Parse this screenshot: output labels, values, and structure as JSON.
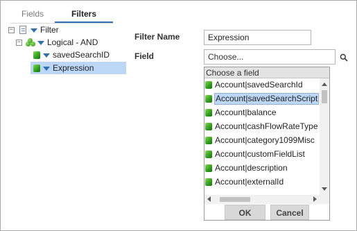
{
  "tabs": {
    "fields": "Fields",
    "filters": "Filters",
    "active": "Filters"
  },
  "tree": {
    "root": {
      "label": "Filter",
      "toggle": "−"
    },
    "logical": {
      "label": "Logical - AND",
      "toggle": "−"
    },
    "children": [
      {
        "label": "savedSearchID",
        "selected": false
      },
      {
        "label": "Expression",
        "selected": true
      }
    ]
  },
  "form": {
    "filter_name_label": "Filter Name",
    "filter_name_value": "Expression",
    "field_label": "Field",
    "field_placeholder": "Choose..."
  },
  "dropdown": {
    "header": "Choose a field",
    "items": [
      "Account|savedSearchId",
      "Account|savedSearchScript",
      "Account|balance",
      "Account|cashFlowRateType",
      "Account|category1099Misc",
      "Account|customFieldList",
      "Account|description",
      "Account|externalId"
    ],
    "highlighted_index": 1,
    "ok_label": "OK",
    "cancel_label": "Cancel"
  },
  "colors": {
    "accent": "#2f6fb3",
    "selection": "#bcd7f5",
    "icon_green": "#2f9e1a"
  },
  "icons": [
    "doc-icon",
    "triangle-down-icon",
    "logic-and-icon",
    "field-cube-icon",
    "search-icon"
  ]
}
